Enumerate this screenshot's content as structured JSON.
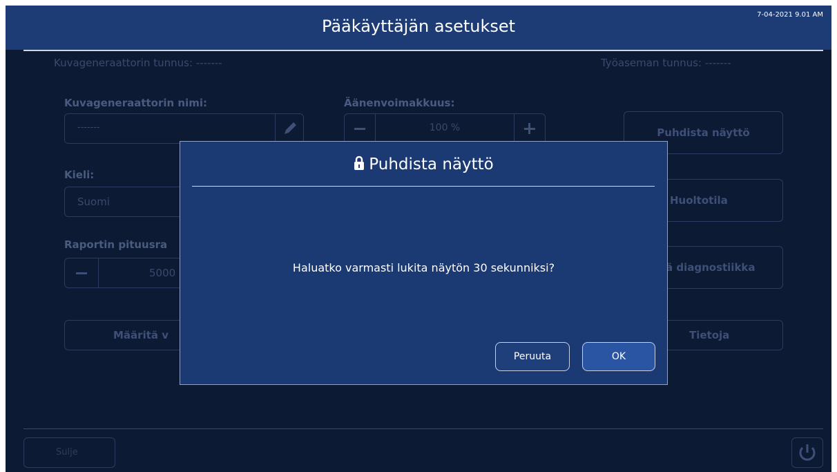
{
  "header": {
    "title": "Pääkäyttäjän asetukset",
    "datetime": "7-04-2021 9.01 AM"
  },
  "settings": {
    "generator_id": "Kuvageneraattorin tunnus: -------",
    "workstation_id": "Työaseman tunnus: -------",
    "generator_name_label": "Kuvageneraattorin nimi:",
    "generator_name_value": "-------",
    "volume_label": "Äänenvoimakkuus:",
    "volume_value": "100 %",
    "language_label": "Kieli:",
    "language_value": "Suomi",
    "report_length_label": "Raportin pituusra",
    "report_length_value": "5000",
    "define_button": "Määritä v"
  },
  "side_buttons": {
    "clean_screen": "Puhdista näyttö",
    "service_mode": "Huoltotila",
    "diagnostics": "ä diagnostiikka",
    "info": "Tietoja"
  },
  "footer": {
    "close_button": "Sulje"
  },
  "dialog": {
    "title": "Puhdista näyttö",
    "message": "Haluatko varmasti lukita näytön 30 sekunniksi?",
    "cancel_label": "Peruuta",
    "ok_label": "OK"
  },
  "colors": {
    "background": "#0d1a33",
    "header": "#1d3b74",
    "dialog": "#1b3972",
    "ok_button": "#2a55a3"
  },
  "icons": [
    "pencil-icon",
    "minus-icon",
    "plus-icon",
    "lock-icon",
    "power-icon"
  ]
}
